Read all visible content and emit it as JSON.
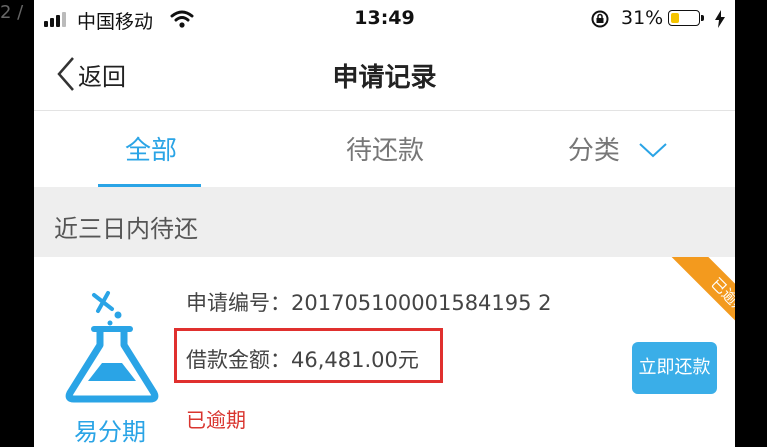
{
  "corner_text": "2 /",
  "status_bar": {
    "carrier": "中国移动",
    "time": "13:49",
    "battery_percent": "31%",
    "battery_level": 0.31
  },
  "nav": {
    "back_label": "返回",
    "title": "申请记录"
  },
  "tabs": [
    {
      "label": "全部",
      "active": true
    },
    {
      "label": "待还款",
      "active": false
    },
    {
      "label": "分类",
      "active": false
    }
  ],
  "section": {
    "title": "近三日内待还"
  },
  "record": {
    "product_name": "易分期",
    "app_no_label": "申请编号：",
    "app_no": "201705100001584195 2",
    "amount_label": "借款金额：",
    "amount": "46,481.00元",
    "status": "已逾期",
    "ribbon": "已逾期",
    "repay_button": "立即还款"
  },
  "colors": {
    "accent": "#2aa4e6",
    "overdue": "#d9352f",
    "ribbon": "#f39a1e",
    "highlight": "#e0302e"
  }
}
